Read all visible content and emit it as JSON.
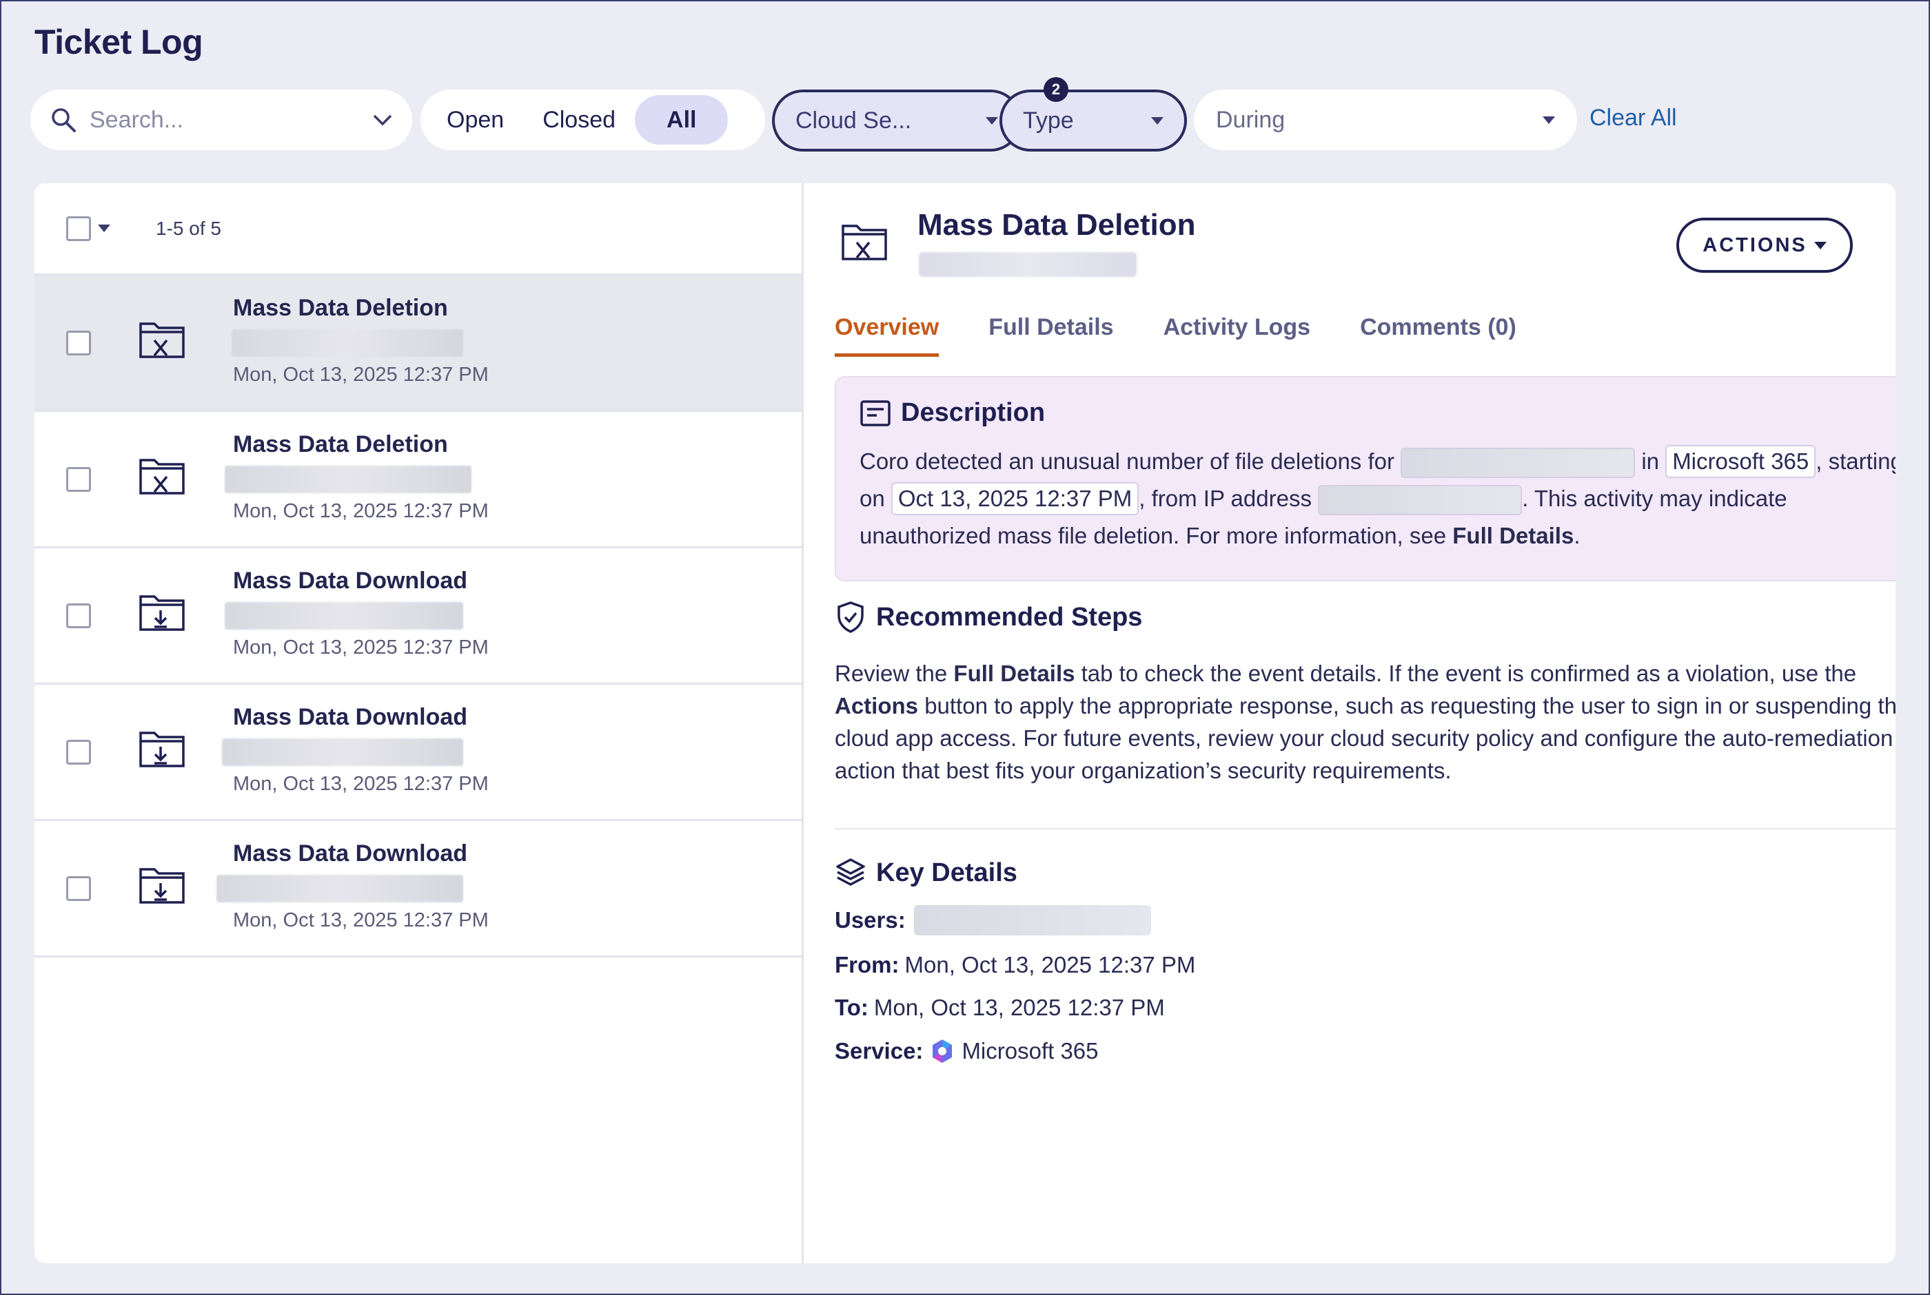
{
  "page": {
    "title": "Ticket Log"
  },
  "filters": {
    "search_placeholder": "Search...",
    "status_tabs": [
      "Open",
      "Closed",
      "All"
    ],
    "status_selected": "All",
    "cloud_chip": "Cloud Se...",
    "type_chip": "Type",
    "type_badge": "2",
    "during_label": "During",
    "clear_all": "Clear All"
  },
  "list": {
    "count_label": "1-5 of 5",
    "tickets": [
      {
        "name": "Mass Data Deletion",
        "date": "Mon, Oct 13, 2025 12:37 PM",
        "icon": "folder-x-icon"
      },
      {
        "name": "Mass Data Deletion",
        "date": "Mon, Oct 13, 2025 12:37 PM",
        "icon": "folder-x-icon"
      },
      {
        "name": "Mass Data Download",
        "date": "Mon, Oct 13, 2025 12:37 PM",
        "icon": "folder-download-icon"
      },
      {
        "name": "Mass Data Download",
        "date": "Mon, Oct 13, 2025 12:37 PM",
        "icon": "folder-download-icon"
      },
      {
        "name": "Mass Data Download",
        "date": "Mon, Oct 13, 2025 12:37 PM",
        "icon": "folder-download-icon"
      }
    ]
  },
  "detail": {
    "title": "Mass Data Deletion",
    "actions_label": "ACTIONS",
    "tabs": [
      "Overview",
      "Full Details",
      "Activity Logs",
      "Comments (0)"
    ],
    "active_tab": "Overview",
    "description": {
      "heading": "Description",
      "p1": "Coro detected an unusual number of file deletions for",
      "p2": "in",
      "service_tag": "Microsoft 365",
      "p3": ", starting on",
      "date_tag": "Oct 13, 2025 12:37 PM",
      "p4": ", from IP address",
      "p5": ". This activity may indicate unauthorized mass file deletion. For more information, see",
      "link": "Full Details",
      "end": "."
    },
    "recommended": {
      "heading": "Recommended Steps",
      "t1": "Review the",
      "b1": "Full Details",
      "t2": "tab to check the event details. If the event is confirmed as a violation, use the",
      "b2": "Actions",
      "t3": "button to apply the appropriate response, such as requesting the user to sign in or suspending their cloud app access. For future events, review your cloud security policy and configure the auto-remediation action that best fits your organization’s security requirements."
    },
    "key_details": {
      "heading": "Key Details",
      "users_label": "Users:",
      "from_label": "From:",
      "from_value": "Mon, Oct 13, 2025 12:37 PM",
      "to_label": "To:",
      "to_value": "Mon, Oct 13, 2025 12:37 PM",
      "service_label": "Service:",
      "service_value": "Microsoft 365"
    }
  },
  "colors": {
    "accent_tab": "#c55a1a",
    "link": "#1d5fa6",
    "navy": "#1f2050",
    "description_bg": "#f3e9f8"
  }
}
